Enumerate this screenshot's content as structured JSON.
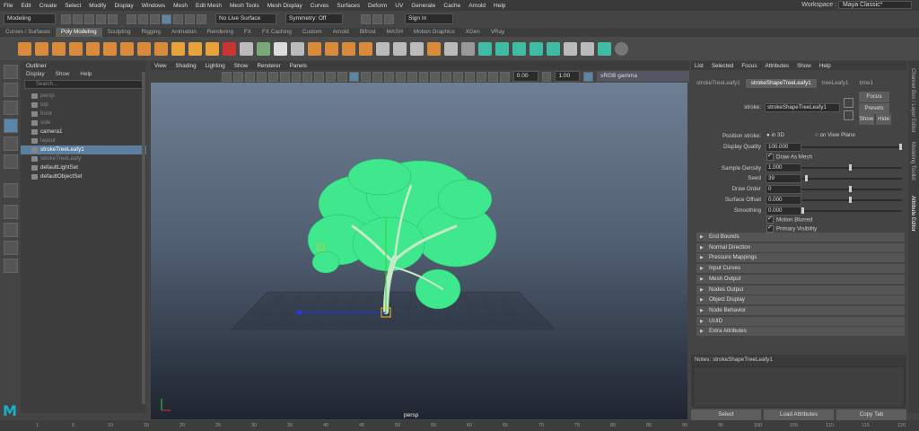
{
  "menubar": {
    "items": [
      "File",
      "Edit",
      "Create",
      "Select",
      "Modify",
      "Display",
      "Windows",
      "Mesh",
      "Edit Mesh",
      "Mesh Tools",
      "Mesh Display",
      "Curves",
      "Surfaces",
      "Deform",
      "UV",
      "Generate",
      "Cache",
      "Arnold",
      "Help"
    ],
    "workspace_label": "Workspace :",
    "workspace_value": "Maya Classic*"
  },
  "statusline": {
    "mode": "Modeling",
    "live_surface": "No Live Surface",
    "symmetry": "Symmetry: Off",
    "sign_in": "Sign In"
  },
  "shelf": {
    "tabs": [
      "Curves / Surfaces",
      "Poly Modeling",
      "Sculpting",
      "Rigging",
      "Animation",
      "Rendering",
      "FX",
      "FX Caching",
      "Custom",
      "Arnold",
      "Bifrost",
      "MASH",
      "Motion Graphics",
      "XGen",
      "VRay"
    ],
    "active_tab": "Poly Modeling"
  },
  "outliner": {
    "title": "Outliner",
    "menus": [
      "Display",
      "Show",
      "Help"
    ],
    "search_placeholder": "Search...",
    "items": [
      {
        "label": "persp",
        "dim": true
      },
      {
        "label": "top",
        "dim": true
      },
      {
        "label": "front",
        "dim": true
      },
      {
        "label": "side",
        "dim": true
      },
      {
        "label": "camera1",
        "dim": false
      },
      {
        "label": "layout",
        "dim": true
      },
      {
        "label": "strokeTreeLeafy1",
        "dim": false,
        "selected": true
      },
      {
        "label": "strokeTreeLeafy",
        "dim": true
      },
      {
        "label": "defaultLightSet",
        "dim": false
      },
      {
        "label": "defaultObjectSet",
        "dim": false
      }
    ]
  },
  "viewport": {
    "menus": [
      "View",
      "Shading",
      "Lighting",
      "Show",
      "Renderer",
      "Panels"
    ],
    "exposure": "0.00",
    "gamma": "1.00",
    "colorspace": "sRGB gamma",
    "camera": "persp"
  },
  "attribute_editor": {
    "menus": [
      "List",
      "Selected",
      "Focus",
      "Attributes",
      "Show",
      "Help"
    ],
    "tabs": [
      "strokeTreeLeafy1",
      "strokeShapeTreeLeafy1",
      "treeLeafy1",
      "time1"
    ],
    "active_tab": "strokeShapeTreeLeafy1",
    "focus_label": "Focus",
    "presets_label": "Presets",
    "show_label": "Show",
    "hide_label": "Hide",
    "node_label": "stroke:",
    "node_value": "strokeShapeTreeLeafy1",
    "position_stroke_label": "Position stroke:",
    "position_in3d": "in 3D",
    "position_view_plane": "on View Plane",
    "display_quality_label": "Display Quality",
    "display_quality": "100.000",
    "draw_as_mesh": "Draw As Mesh",
    "sample_density_label": "Sample Density",
    "sample_density": "1.000",
    "seed_label": "Seed",
    "seed": "39",
    "draw_order_label": "Draw Order",
    "draw_order": "0",
    "surface_offset_label": "Surface Offset",
    "surface_offset": "0.000",
    "smoothing_label": "Smoothing",
    "smoothing": "0.000",
    "motion_blurred": "Motion Blurred",
    "primary_visibility": "Primary Visibility",
    "sections": [
      "End Bounds",
      "Normal Direction",
      "Pressure Mappings",
      "Input Curves",
      "Mesh Output",
      "Nodes Output",
      "Object Display",
      "Node Behavior",
      "UUID",
      "Extra Attributes"
    ],
    "notes_label": "Notes:",
    "notes_value": "strokeShapeTreeLeafy1",
    "buttons": [
      "Select",
      "Load Attributes",
      "Copy Tab"
    ]
  },
  "side_tabs": [
    "Channel Box / Layer Editor",
    "Modeling Toolkit",
    "Attribute Editor"
  ],
  "timeline_ticks": [
    "1",
    "5",
    "10",
    "15",
    "20",
    "25",
    "30",
    "35",
    "40",
    "45",
    "50",
    "55",
    "60",
    "65",
    "70",
    "75",
    "80",
    "85",
    "90",
    "95",
    "100",
    "105",
    "110",
    "115",
    "120"
  ],
  "colors": {
    "accent": "#5d7f9f",
    "tree": "#3fe88d",
    "trunk": "#c8e8c8",
    "logo": "#19b3c7"
  }
}
